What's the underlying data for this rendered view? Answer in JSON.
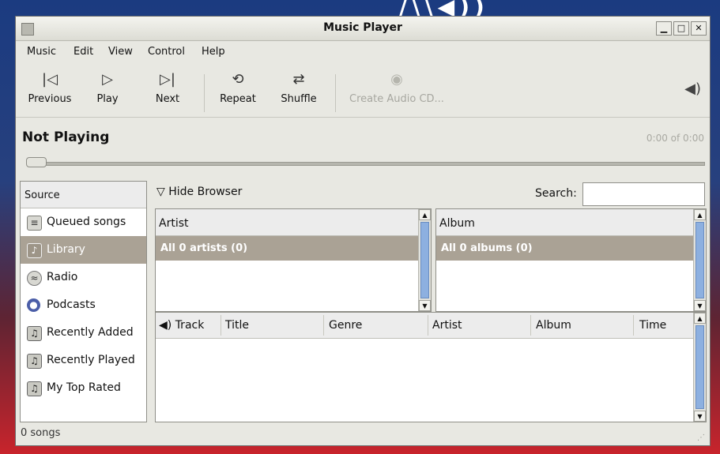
{
  "window": {
    "title": "Music Player"
  },
  "menu": [
    "Music",
    "Edit",
    "View",
    "Control",
    "Help"
  ],
  "toolbar": {
    "previous": "Previous",
    "play": "Play",
    "next": "Next",
    "repeat": "Repeat",
    "shuffle": "Shuffle",
    "create_cd": "Create Audio CD..."
  },
  "player": {
    "status": "Not Playing",
    "time": "0:00 of 0:00"
  },
  "source": {
    "header": "Source",
    "items": [
      "Queued songs",
      "Library",
      "Radio",
      "Podcasts",
      "Recently Added",
      "Recently Played",
      "My Top Rated"
    ],
    "selected": "Library"
  },
  "browser": {
    "toggle_label": "Hide Browser"
  },
  "search": {
    "label": "Search:",
    "value": ""
  },
  "artist_pane": {
    "header": "Artist",
    "selected": "All 0 artists (0)"
  },
  "album_pane": {
    "header": "Album",
    "selected": "All 0 albums (0)"
  },
  "tracks": {
    "columns": [
      "Track",
      "Title",
      "Genre",
      "Artist",
      "Album",
      "Time"
    ]
  },
  "status": {
    "text": "0 songs"
  },
  "colors": {
    "selection": "#aaa295",
    "scroll_thumb": "#8db0e0"
  }
}
